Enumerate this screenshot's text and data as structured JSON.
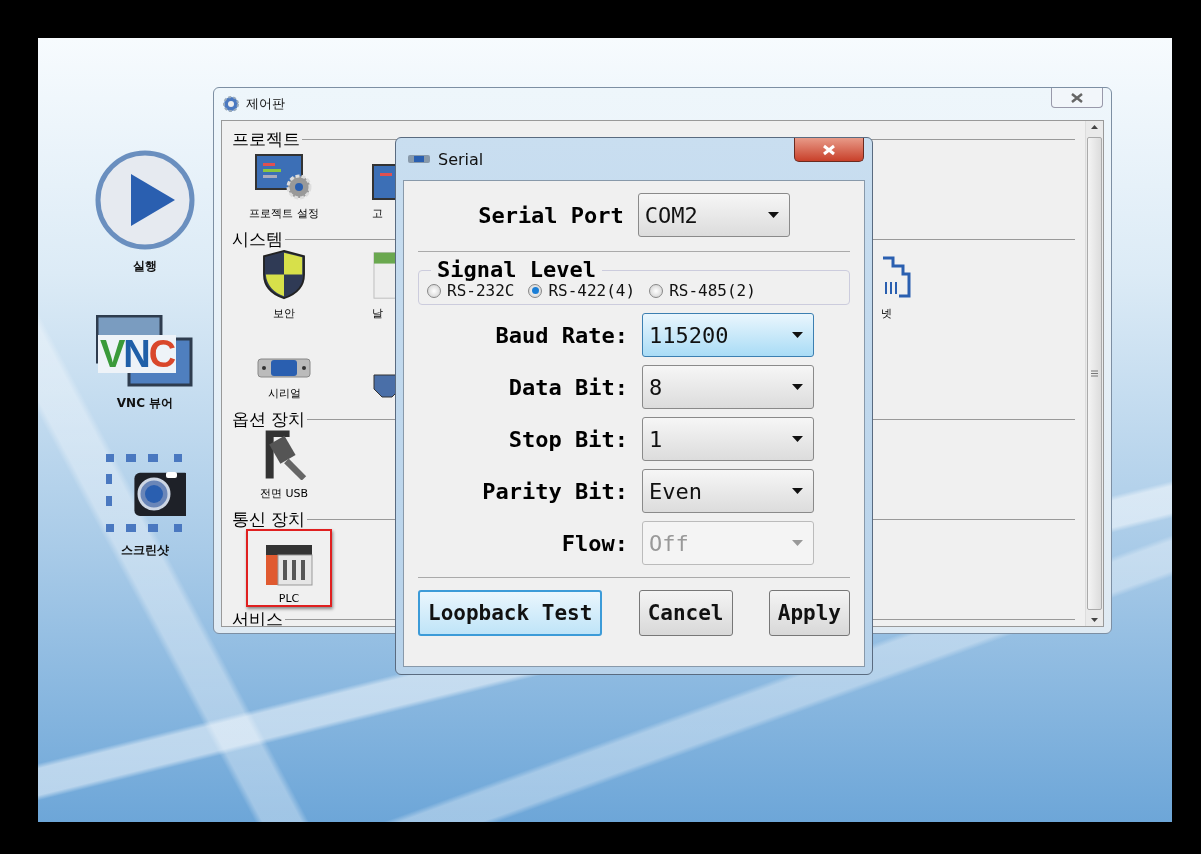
{
  "desktop_icons": [
    {
      "kind": "play",
      "label": "실행"
    },
    {
      "kind": "vnc",
      "label": "VNC 뷰어",
      "logo_letters": [
        {
          "text": "V",
          "color": "#3a9a3a"
        },
        {
          "text": "N",
          "color": "#1f5fa8"
        },
        {
          "text": "C",
          "color": "#d9472b"
        }
      ]
    },
    {
      "kind": "screenshot",
      "label": "스크린샷"
    }
  ],
  "control_panel": {
    "title": "제어판",
    "sections": [
      {
        "heading": "프로젝트",
        "rows": [
          {
            "items": [
              {
                "kind": "project",
                "label": "프로젝트 설정",
                "selected": false
              },
              {
                "kind": "monitor",
                "label": "고",
                "selected": false
              }
            ],
            "right_items": []
          }
        ]
      },
      {
        "heading": "시스템",
        "rows": [
          {
            "items": [
              {
                "kind": "shield",
                "label": "보안",
                "selected": false
              },
              {
                "kind": "calendar",
                "label": "날",
                "selected": false
              }
            ],
            "right_items": [
              {
                "kind": "network",
                "label": "넷",
                "selected": false
              }
            ]
          },
          {
            "items": [
              {
                "kind": "serial",
                "label": "시리얼",
                "selected": false
              },
              {
                "kind": "port",
                "selected": false
              }
            ],
            "right_items": []
          }
        ]
      },
      {
        "heading": "옵션 장치",
        "rows": [
          {
            "items": [
              {
                "kind": "usb",
                "label": "전면 USB",
                "selected": false
              }
            ],
            "right_items": []
          }
        ]
      },
      {
        "heading": "통신 장치",
        "rows": [
          {
            "items": [
              {
                "kind": "plc",
                "label": "PLC",
                "selected": true
              }
            ],
            "right_items": []
          }
        ]
      },
      {
        "heading": "서비스"
      }
    ]
  },
  "serial_dialog": {
    "title": "Serial",
    "serial_port": {
      "label": "Serial Port",
      "value": "COM2"
    },
    "signal_level": {
      "title": "Signal Level",
      "options": [
        {
          "label": "RS-232C",
          "selected": false
        },
        {
          "label": "RS-422(4)",
          "selected": true
        },
        {
          "label": "RS-485(2)",
          "selected": false
        }
      ]
    },
    "fields": [
      {
        "label": "Baud Rate:",
        "value": "115200",
        "focused": true,
        "disabled": false
      },
      {
        "label": "Data Bit:",
        "value": "8",
        "focused": false,
        "disabled": false
      },
      {
        "label": "Stop Bit:",
        "value": "1",
        "focused": false,
        "disabled": false
      },
      {
        "label": "Parity Bit:",
        "value": "Even",
        "focused": false,
        "disabled": false
      },
      {
        "label": "Flow:",
        "value": "Off",
        "focused": false,
        "disabled": true
      }
    ],
    "buttons": [
      {
        "label": "Loopback Test",
        "default": true
      },
      {
        "label": "Cancel",
        "default": false
      },
      {
        "label": "Apply",
        "default": false
      }
    ]
  }
}
